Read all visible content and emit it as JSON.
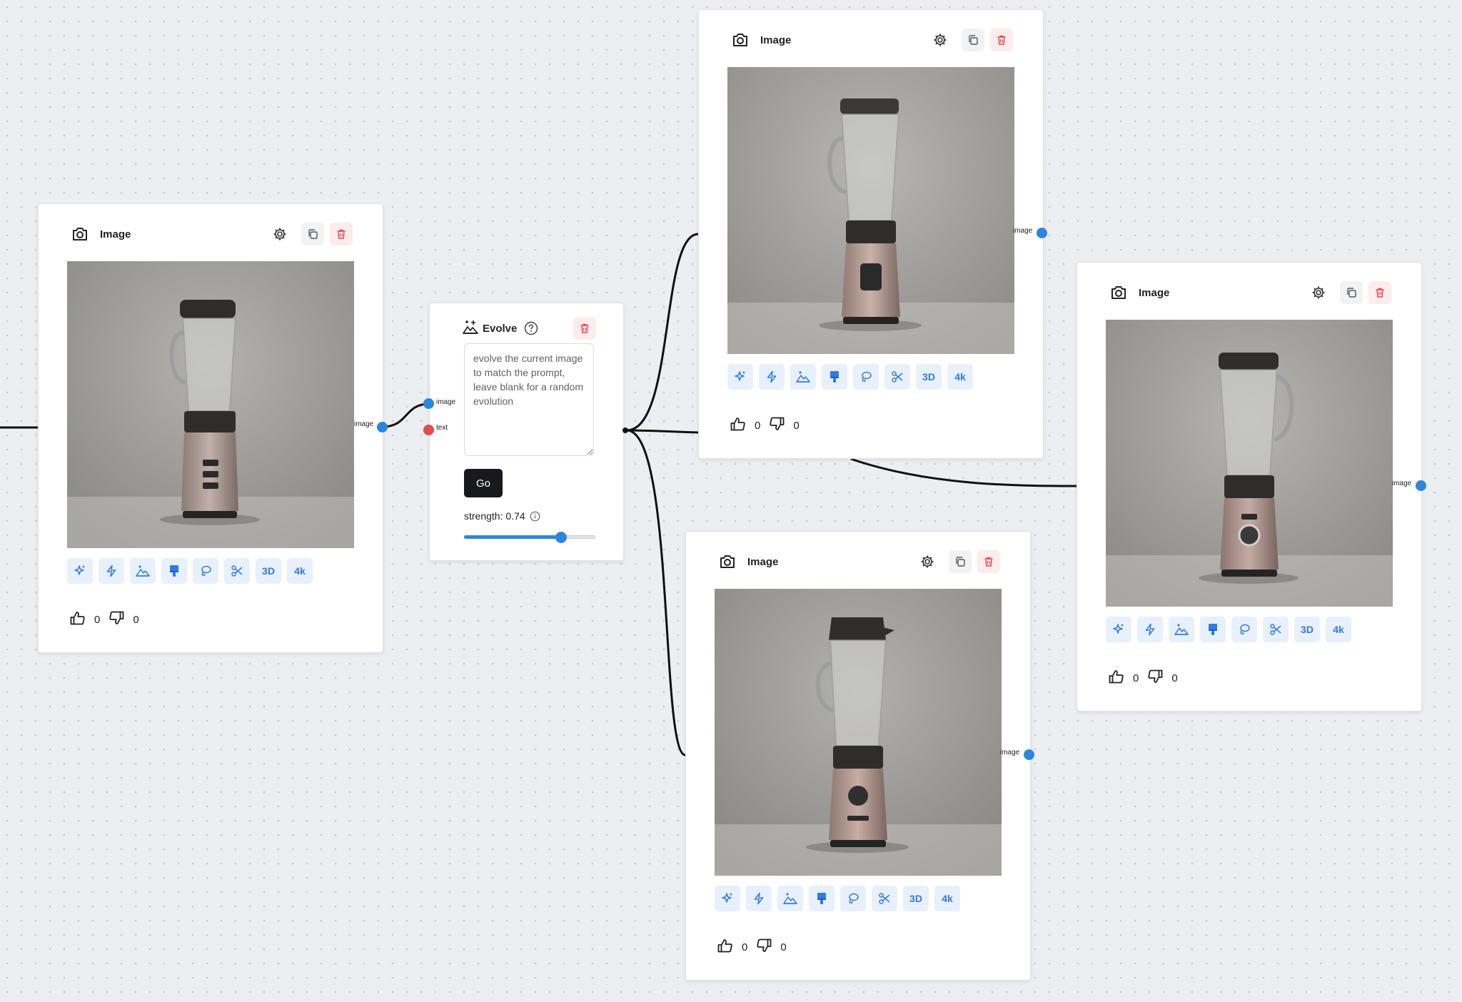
{
  "canvas": {
    "background": "#eceef2"
  },
  "colors": {
    "accent": "#2f7be5",
    "port_blue": "#2b87db",
    "port_red": "#e24c4b",
    "danger": "#e5484d"
  },
  "image_nodes": [
    {
      "id": "image-node-1",
      "title": "Image",
      "output_label": "image",
      "likes": "0",
      "dislikes": "0"
    },
    {
      "id": "image-node-2",
      "title": "Image",
      "output_label": "image",
      "likes": "0",
      "dislikes": "0"
    },
    {
      "id": "image-node-3",
      "title": "Image",
      "output_label": "image",
      "likes": "0",
      "dislikes": "0"
    },
    {
      "id": "image-node-4",
      "title": "Image",
      "output_label": "image",
      "likes": "0",
      "dislikes": "0"
    }
  ],
  "toolbar": {
    "tools": [
      {
        "icon": "sparkles-icon"
      },
      {
        "icon": "lightning-icon"
      },
      {
        "icon": "landscape-icon"
      },
      {
        "icon": "paint-brush-icon"
      },
      {
        "icon": "lasso-icon"
      },
      {
        "icon": "scissors-icon"
      },
      {
        "label": "3D"
      },
      {
        "label": "4k"
      }
    ],
    "label_3d": "3D",
    "label_4k": "4k"
  },
  "evolve": {
    "title": "Evolve",
    "input_image_label": "image",
    "input_text_label": "text",
    "prompt_placeholder": "evolve the current image to match the prompt, leave blank for a random evolution",
    "go_label": "Go",
    "strength_label": "strength: 0.74",
    "strength_value": 0.74
  }
}
